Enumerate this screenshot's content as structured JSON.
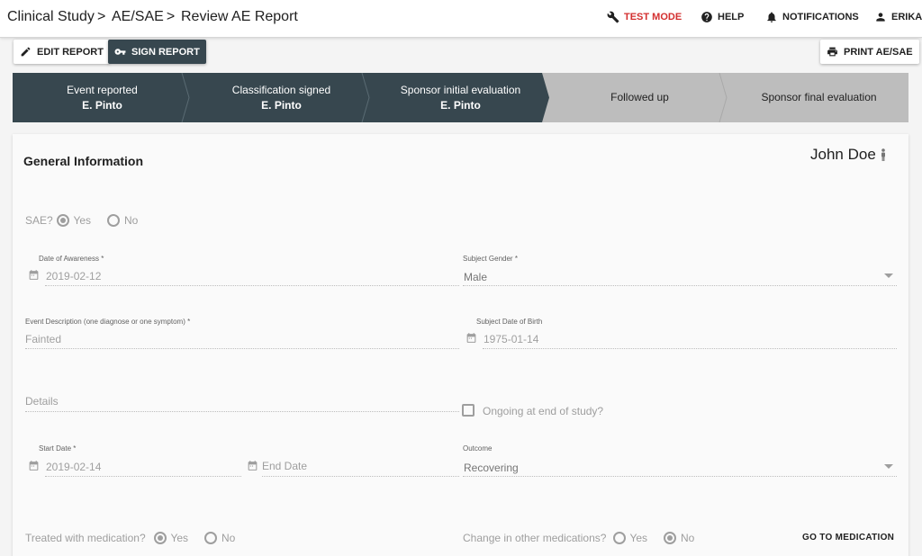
{
  "breadcrumb": [
    "Clinical Study",
    "AE/SAE",
    "Review AE Report"
  ],
  "breadcrumb_separator": ">",
  "topnav": {
    "test_mode": "TEST MODE",
    "help": "HELP",
    "notifications": "NOTIFICATIONS",
    "user": "ERIKA"
  },
  "toolbar": {
    "edit_report": "EDIT REPORT",
    "sign_report": "SIGN REPORT",
    "print": "PRINT AE/SAE"
  },
  "steps": [
    {
      "title": "Event reported",
      "sub": "E. Pinto",
      "status": "done"
    },
    {
      "title": "Classification signed",
      "sub": "E. Pinto",
      "status": "done"
    },
    {
      "title": "Sponsor initial evaluation",
      "sub": "E. Pinto",
      "status": "done"
    },
    {
      "title": "Followed up",
      "sub": "",
      "status": "todo"
    },
    {
      "title": "Sponsor final evaluation",
      "sub": "",
      "status": "todo"
    }
  ],
  "card": {
    "title": "General Information",
    "patient": "John Doe"
  },
  "sae": {
    "label": "SAE?",
    "yes": "Yes",
    "no": "No",
    "selected": "Yes"
  },
  "fields": {
    "date_awareness": {
      "label": "Date of Awareness *",
      "value": "2019-02-12"
    },
    "gender": {
      "label": "Subject Gender *",
      "value": "Male"
    },
    "event_desc": {
      "label": "Event Description (one diagnose or one symptom) *",
      "value": "Fainted"
    },
    "dob": {
      "label": "Subject Date of Birth",
      "value": "1975-01-14"
    },
    "details": {
      "placeholder": "Details"
    },
    "ongoing": {
      "label": "Ongoing at end of study?",
      "checked": false
    },
    "start_date": {
      "label": "Start Date *",
      "value": "2019-02-14"
    },
    "end_date": {
      "placeholder": "End Date"
    },
    "outcome": {
      "label": "Outcome",
      "value": "Recovering"
    }
  },
  "treated": {
    "label": "Treated with medication?",
    "yes": "Yes",
    "no": "No",
    "selected": "Yes"
  },
  "change_meds": {
    "label": "Change in other medications?",
    "yes": "Yes",
    "no": "No",
    "selected": "No"
  },
  "go_to_medication": "GO TO MEDICATION",
  "colors": {
    "step_done": "#37474f",
    "step_todo": "#bdbdbd",
    "test_mode": "#d32f2f"
  }
}
